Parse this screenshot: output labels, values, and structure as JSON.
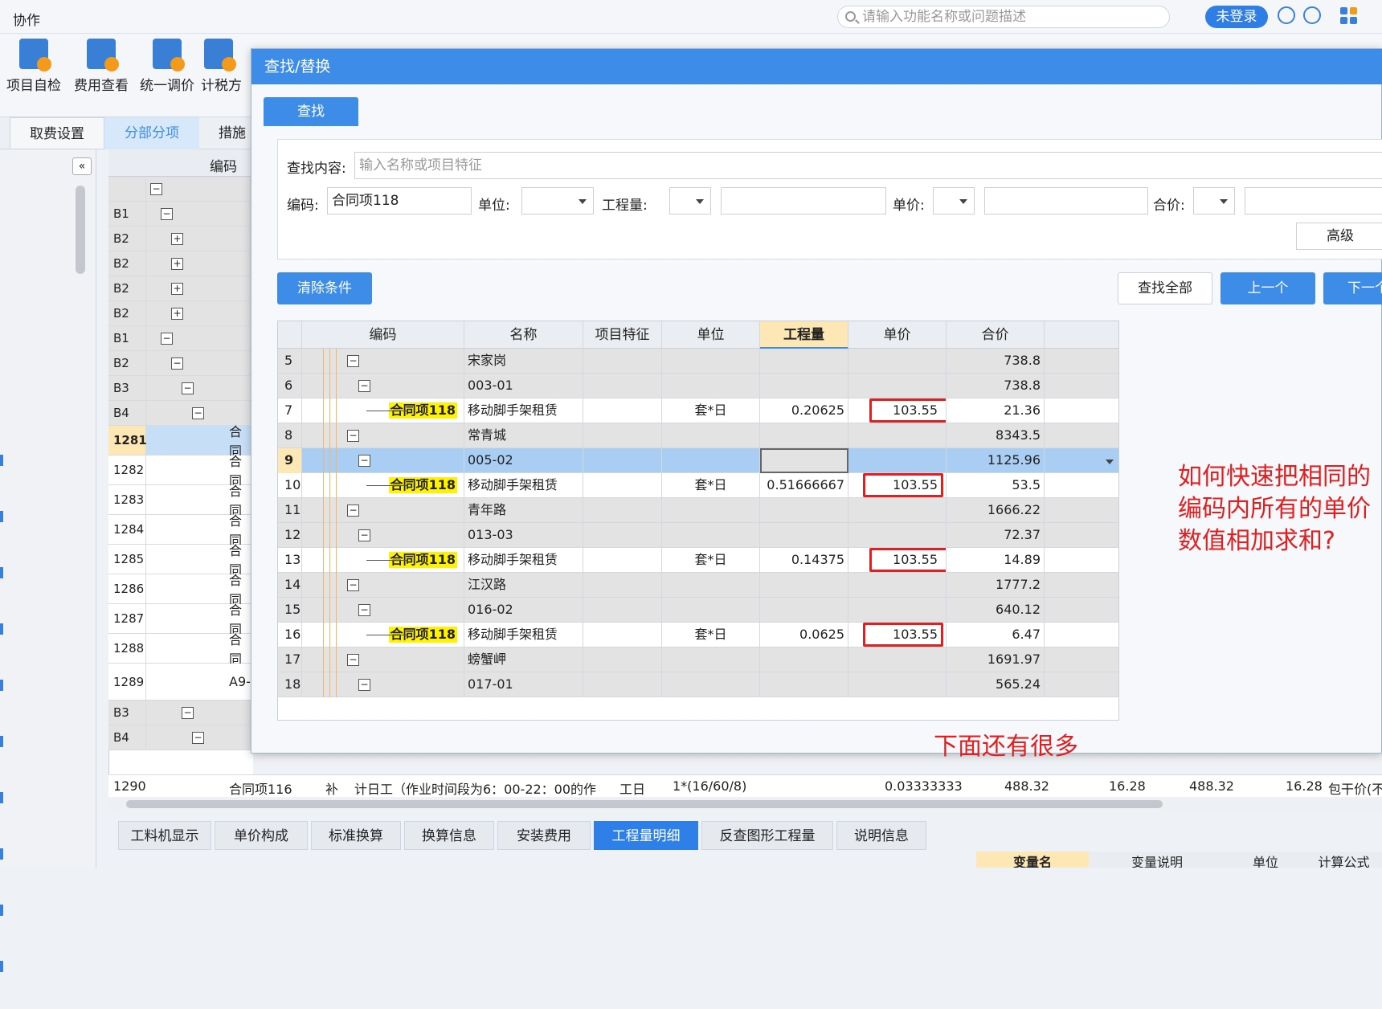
{
  "app": {
    "title": "协作",
    "search_placeholder": "请输入功能名称或问题描述",
    "login_label": "未登录"
  },
  "toolbar": [
    {
      "label": "项目自检"
    },
    {
      "label": "费用查看"
    },
    {
      "label": "统一调价"
    },
    {
      "label": "计税方"
    }
  ],
  "main_tabs": [
    "取费设置",
    "分部分项",
    "措施"
  ],
  "left_grid": {
    "header": "编码",
    "rows": [
      {
        "num": "",
        "text": ""
      },
      {
        "num": "B1",
        "text": ""
      },
      {
        "num": "B2",
        "text": ""
      },
      {
        "num": "B2",
        "text": ""
      },
      {
        "num": "B2",
        "text": ""
      },
      {
        "num": "B2",
        "text": ""
      },
      {
        "num": "B1",
        "text": ""
      },
      {
        "num": "B2",
        "text": ""
      },
      {
        "num": "B3",
        "text": ""
      },
      {
        "num": "B4",
        "text": ""
      },
      {
        "num": "1281",
        "text": "合同"
      },
      {
        "num": "1282",
        "text": "合同"
      },
      {
        "num": "1283",
        "text": "合同"
      },
      {
        "num": "1284",
        "text": "合同"
      },
      {
        "num": "1285",
        "text": "合同"
      },
      {
        "num": "1286",
        "text": "合同"
      },
      {
        "num": "1287",
        "text": "合同"
      },
      {
        "num": "1288",
        "text": "合同"
      },
      {
        "num": "1289",
        "text": "A9-"
      },
      {
        "num": "B3",
        "text": ""
      },
      {
        "num": "B4",
        "text": ""
      }
    ],
    "bottom_row": {
      "num": "1290",
      "code": "合同项116",
      "type": "补",
      "name": "计日工（作业时间段为6：00-22：00的作",
      "unit": "工日",
      "formula": "1*(16/60/8)",
      "qty": "0.03333333",
      "p1": "488.32",
      "p2": "16.28",
      "p3": "488.32",
      "p4": "16.28",
      "note": "包干价(不"
    }
  },
  "bottom_tabs": [
    "工料机显示",
    "单价构成",
    "标准换算",
    "换算信息",
    "安装费用",
    "工程量明细",
    "反查图形工程量",
    "说明信息"
  ],
  "bottom_tab_active": "工程量明细",
  "sub_headers": [
    "变量名",
    "变量说明",
    "单位",
    "计算公式"
  ],
  "dialog": {
    "title": "查找/替换",
    "tab_find": "查找",
    "find_label": "查找内容:",
    "find_placeholder": "输入名称或项目特征",
    "code_label": "编码:",
    "code_value": "合同项118",
    "unit_label": "单位:",
    "qty_label": "工程量:",
    "price_label": "单价:",
    "total_label": "合价:",
    "advanced_label": "高级",
    "clear_label": "清除条件",
    "find_all_label": "查找全部",
    "prev_label": "上一个",
    "next_label": "下一个",
    "columns": [
      "编码",
      "名称",
      "项目特征",
      "单位",
      "工程量",
      "单价",
      "合价"
    ],
    "rows": [
      {
        "n": "5",
        "level": 1,
        "type": "group",
        "code": "",
        "name": "宋家岗",
        "unit": "",
        "qty": "",
        "price": "",
        "total": "738.8"
      },
      {
        "n": "6",
        "level": 2,
        "type": "group",
        "code": "",
        "name": "003-01",
        "unit": "",
        "qty": "",
        "price": "",
        "total": "738.8"
      },
      {
        "n": "7",
        "level": 3,
        "type": "item",
        "code": "合同项118",
        "name": "移动脚手架租赁",
        "unit": "套*日",
        "qty": "0.20625",
        "price": "103.55",
        "total": "21.36"
      },
      {
        "n": "8",
        "level": 1,
        "type": "group",
        "code": "",
        "name": "常青城",
        "unit": "",
        "qty": "",
        "price": "",
        "total": "8343.5"
      },
      {
        "n": "9",
        "level": 2,
        "type": "selected",
        "code": "",
        "name": "005-02",
        "unit": "",
        "qty": "",
        "price": "",
        "total": "1125.96"
      },
      {
        "n": "10",
        "level": 3,
        "type": "item",
        "code": "合同项118",
        "name": "移动脚手架租赁",
        "unit": "套*日",
        "qty": "0.51666667",
        "price": "103.55",
        "total": "53.5"
      },
      {
        "n": "11",
        "level": 1,
        "type": "group",
        "code": "",
        "name": "青年路",
        "unit": "",
        "qty": "",
        "price": "",
        "total": "1666.22"
      },
      {
        "n": "12",
        "level": 2,
        "type": "group",
        "code": "",
        "name": "013-03",
        "unit": "",
        "qty": "",
        "price": "",
        "total": "72.37"
      },
      {
        "n": "13",
        "level": 3,
        "type": "item",
        "code": "合同项118",
        "name": "移动脚手架租赁",
        "unit": "套*日",
        "qty": "0.14375",
        "price": "103.55",
        "total": "14.89"
      },
      {
        "n": "14",
        "level": 1,
        "type": "group",
        "code": "",
        "name": "江汉路",
        "unit": "",
        "qty": "",
        "price": "",
        "total": "1777.2"
      },
      {
        "n": "15",
        "level": 2,
        "type": "group",
        "code": "",
        "name": "016-02",
        "unit": "",
        "qty": "",
        "price": "",
        "total": "640.12"
      },
      {
        "n": "16",
        "level": 3,
        "type": "item",
        "code": "合同项118",
        "name": "移动脚手架租赁",
        "unit": "套*日",
        "qty": "0.0625",
        "price": "103.55",
        "total": "6.47"
      },
      {
        "n": "17",
        "level": 1,
        "type": "group",
        "code": "",
        "name": "螃蟹岬",
        "unit": "",
        "qty": "",
        "price": "",
        "total": "1691.97"
      },
      {
        "n": "18",
        "level": 2,
        "type": "group",
        "code": "",
        "name": "017-01",
        "unit": "",
        "qty": "",
        "price": "",
        "total": "565.24"
      }
    ]
  },
  "annotations": {
    "question": "如何快速把相同的编码内所有的单价数值相加求和?",
    "more": "下面还有很多",
    "color": "#e02020"
  },
  "colors": {
    "accent": "#3c8ce8",
    "highlight": "#fff200",
    "selected_row": "#a9cdf3"
  }
}
